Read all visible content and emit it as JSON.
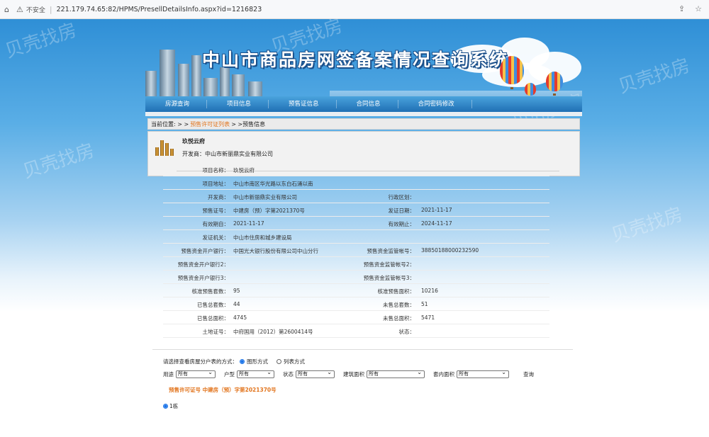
{
  "browser": {
    "security_label": "不安全",
    "url": "221.179.74.65:82/HPMS/PresellDetailsInfo.aspx?id=1216823"
  },
  "watermark": "贝壳找房",
  "header": {
    "title": "中山市商品房网签备案情况查询系统"
  },
  "nav": {
    "items": [
      "房源查询",
      "项目信息",
      "预售证信息",
      "合同信息",
      "合同密码修改"
    ]
  },
  "breadcrumb": {
    "prefix": "当前位置: > >",
    "link": "预售许可证列表",
    "current": "> >预售信息"
  },
  "project_card": {
    "name": "玖悦云府",
    "developer": "开发商：中山市新丽鼎实业有限公司"
  },
  "details": {
    "rows": [
      {
        "l1": "项目名称：",
        "v1": "玖悦云府",
        "l2": "",
        "v2": ""
      },
      {
        "l1": "项目地址：",
        "v1": "中山市南区华光路以东白石涌以南",
        "l2": "",
        "v2": ""
      },
      {
        "l1": "开发商：",
        "v1": "中山市新丽鼎实业有限公司",
        "l2": "行政区划：",
        "v2": ""
      },
      {
        "l1": "预售证号：",
        "v1": "中建房（预）字第2021370号",
        "l2": "发证日期：",
        "v2": "2021-11-17"
      },
      {
        "l1": "有效期自：",
        "v1": "2021-11-17",
        "l2": "有效期止：",
        "v2": "2024-11-17"
      },
      {
        "l1": "发证机关：",
        "v1": "中山市住房和城乡建设局",
        "l2": "",
        "v2": ""
      },
      {
        "l1": "预售资金开户银行：",
        "v1": "中国光大银行股份有限公司中山分行",
        "l2": "预售资金监管帐号：",
        "v2": "38850188000232590"
      },
      {
        "l1": "预售资金开户银行2：",
        "v1": "",
        "l2": "预售资金监管帐号2：",
        "v2": ""
      },
      {
        "l1": "预售资金开户银行3：",
        "v1": "",
        "l2": "预售资金监管帐号3：",
        "v2": ""
      },
      {
        "l1": "核准预售套数：",
        "v1": "95",
        "l2": "核准预售面积：",
        "v2": "10216"
      },
      {
        "l1": "已售总套数：",
        "v1": "44",
        "l2": "未售总套数：",
        "v2": "51"
      },
      {
        "l1": "已售总面积：",
        "v1": "4745",
        "l2": "未售总面积：",
        "v2": "5471"
      },
      {
        "l1": "土地证号：",
        "v1": "中府国用（2012）第2600414号",
        "l2": "状态：",
        "v2": ""
      }
    ]
  },
  "view_mode": {
    "prompt": "请选择查看房屋分户表的方式：",
    "options": [
      "图形方式",
      "列表方式"
    ],
    "selected": "图形方式"
  },
  "filters": {
    "items": [
      {
        "label": "用途",
        "value": "所有"
      },
      {
        "label": "户型",
        "value": "所有"
      },
      {
        "label": "状态",
        "value": "所有"
      },
      {
        "label": "建筑面积",
        "value": "所有"
      },
      {
        "label": "套内面积",
        "value": "所有"
      }
    ],
    "query_label": "查询"
  },
  "permit_label": "预售许可证号 中建房（预）字第2021370号",
  "building": {
    "label": "1栋",
    "selected": true
  }
}
